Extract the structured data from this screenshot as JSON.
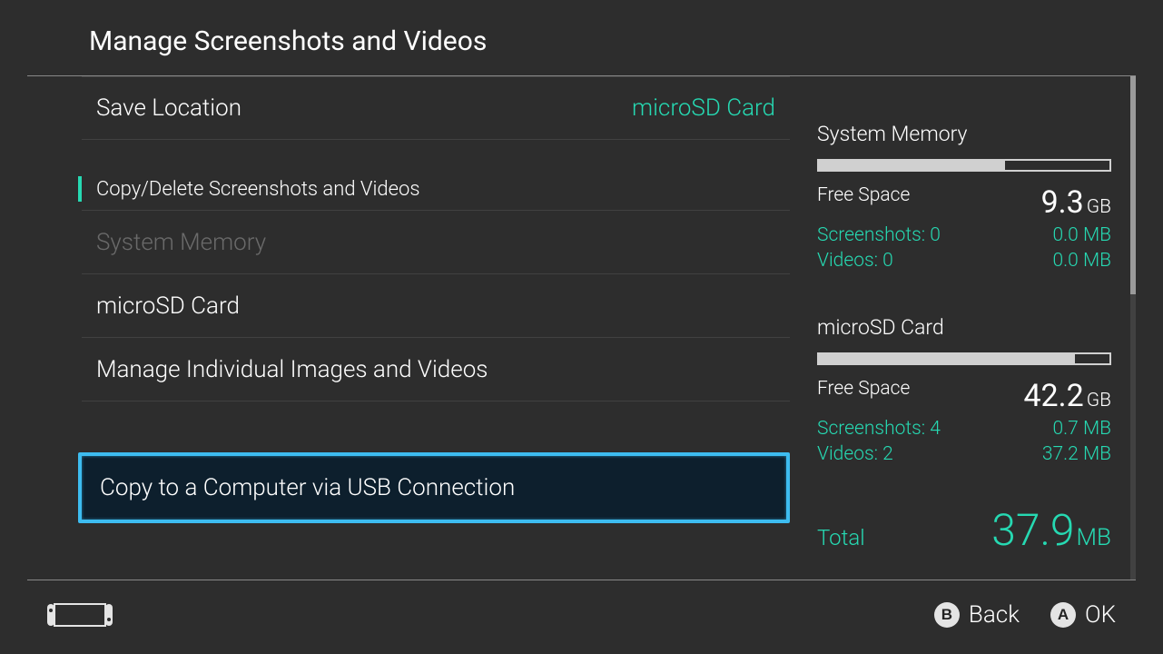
{
  "header": {
    "title": "Manage Screenshots and Videos"
  },
  "menu": {
    "saveLocation": {
      "label": "Save Location",
      "value": "microSD Card"
    },
    "sectionHeader": "Copy/Delete Screenshots and Videos",
    "systemMemory": "System Memory",
    "microSD": "microSD Card",
    "manage": "Manage Individual Images and Videos",
    "usbCopy": "Copy to a Computer via USB Connection"
  },
  "storage": {
    "system": {
      "title": "System Memory",
      "fillPct": 64,
      "freeLabel": "Free Space",
      "freeValue": "9.3",
      "freeUnit": "GB",
      "screenshotsLabel": "Screenshots: 0",
      "screenshotsSize": "0.0 MB",
      "videosLabel": "Videos: 0",
      "videosSize": "0.0 MB"
    },
    "sd": {
      "title": "microSD Card",
      "fillPct": 88,
      "freeLabel": "Free Space",
      "freeValue": "42.2",
      "freeUnit": "GB",
      "screenshotsLabel": "Screenshots: 4",
      "screenshotsSize": "0.7 MB",
      "videosLabel": "Videos: 2",
      "videosSize": "37.2 MB"
    }
  },
  "total": {
    "label": "Total",
    "value": "37.9",
    "unit": "MB"
  },
  "footer": {
    "back": "Back",
    "ok": "OK"
  }
}
